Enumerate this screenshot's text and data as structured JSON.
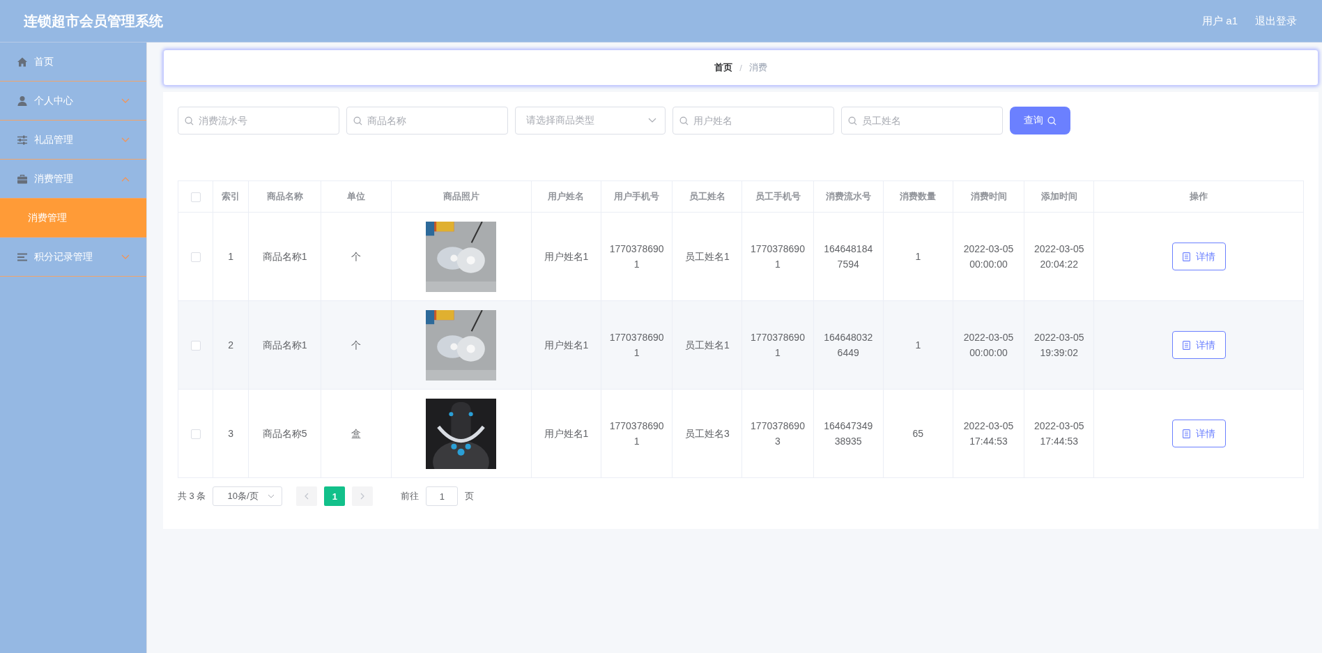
{
  "header": {
    "title": "连锁超市会员管理系统",
    "user": "用户 a1",
    "logout": "退出登录"
  },
  "sidebar": {
    "items": [
      {
        "label": "首页"
      },
      {
        "label": "个人中心",
        "expanded": false
      },
      {
        "label": "礼品管理",
        "expanded": false
      },
      {
        "label": "消费管理",
        "expanded": true,
        "children": [
          {
            "label": "消费管理",
            "selected": true
          }
        ]
      },
      {
        "label": "积分记录管理",
        "expanded": false
      }
    ]
  },
  "breadcrumb": {
    "items": [
      "首页",
      "消费"
    ],
    "separator": "/"
  },
  "search": {
    "fields": [
      {
        "kind": "input",
        "placeholder": "消费流水号"
      },
      {
        "kind": "input",
        "placeholder": "商品名称"
      },
      {
        "kind": "select",
        "placeholder": "请选择商品类型"
      },
      {
        "kind": "input",
        "placeholder": "用户姓名"
      },
      {
        "kind": "input",
        "placeholder": "员工姓名"
      }
    ],
    "button": "查询"
  },
  "table": {
    "all_checked": false,
    "columns": [
      "索引",
      "商品名称",
      "单位",
      "商品照片",
      "用户姓名",
      "用户手机号",
      "员工姓名",
      "员工手机号",
      "消费流水号",
      "消费数量",
      "消费时间",
      "添加时间",
      "操作"
    ],
    "rows": [
      {
        "checked": false,
        "cells": [
          "1",
          "商品名称1",
          "个",
          {
            "kind": "picture"
          },
          "用户姓名1",
          "17703786901",
          "员工姓名1",
          "17703786901",
          "1646481847594",
          "1",
          "2022-03-05 00:00:00",
          "2022-03-05 20:04:22"
        ],
        "action": "详情"
      },
      {
        "checked": false,
        "cells": [
          "2",
          "商品名称1",
          "个",
          {
            "kind": "picture"
          },
          "用户姓名1",
          "17703786901",
          "员工姓名1",
          "17703786901",
          "1646480326449",
          "1",
          "2022-03-05 00:00:00",
          "2022-03-05 19:39:02"
        ],
        "action": "详情"
      },
      {
        "checked": false,
        "cells": [
          "3",
          "商品名称5",
          "盒",
          {
            "kind": "picture"
          },
          "用户姓名1",
          "17703786901",
          "员工姓名3",
          "17703786903",
          "16464734938935",
          "65",
          "2022-03-05 17:44:53",
          "2022-03-05 17:44:53"
        ],
        "action": "详情"
      }
    ]
  },
  "pagination": {
    "total": "共 3 条",
    "page_size": "10条/页",
    "pages": [
      {
        "label": "1",
        "selected": true
      }
    ],
    "prev_disabled": true,
    "next_disabled": true,
    "jump_label": "前往",
    "jump_value": "1",
    "jump_suffix": "页"
  }
}
